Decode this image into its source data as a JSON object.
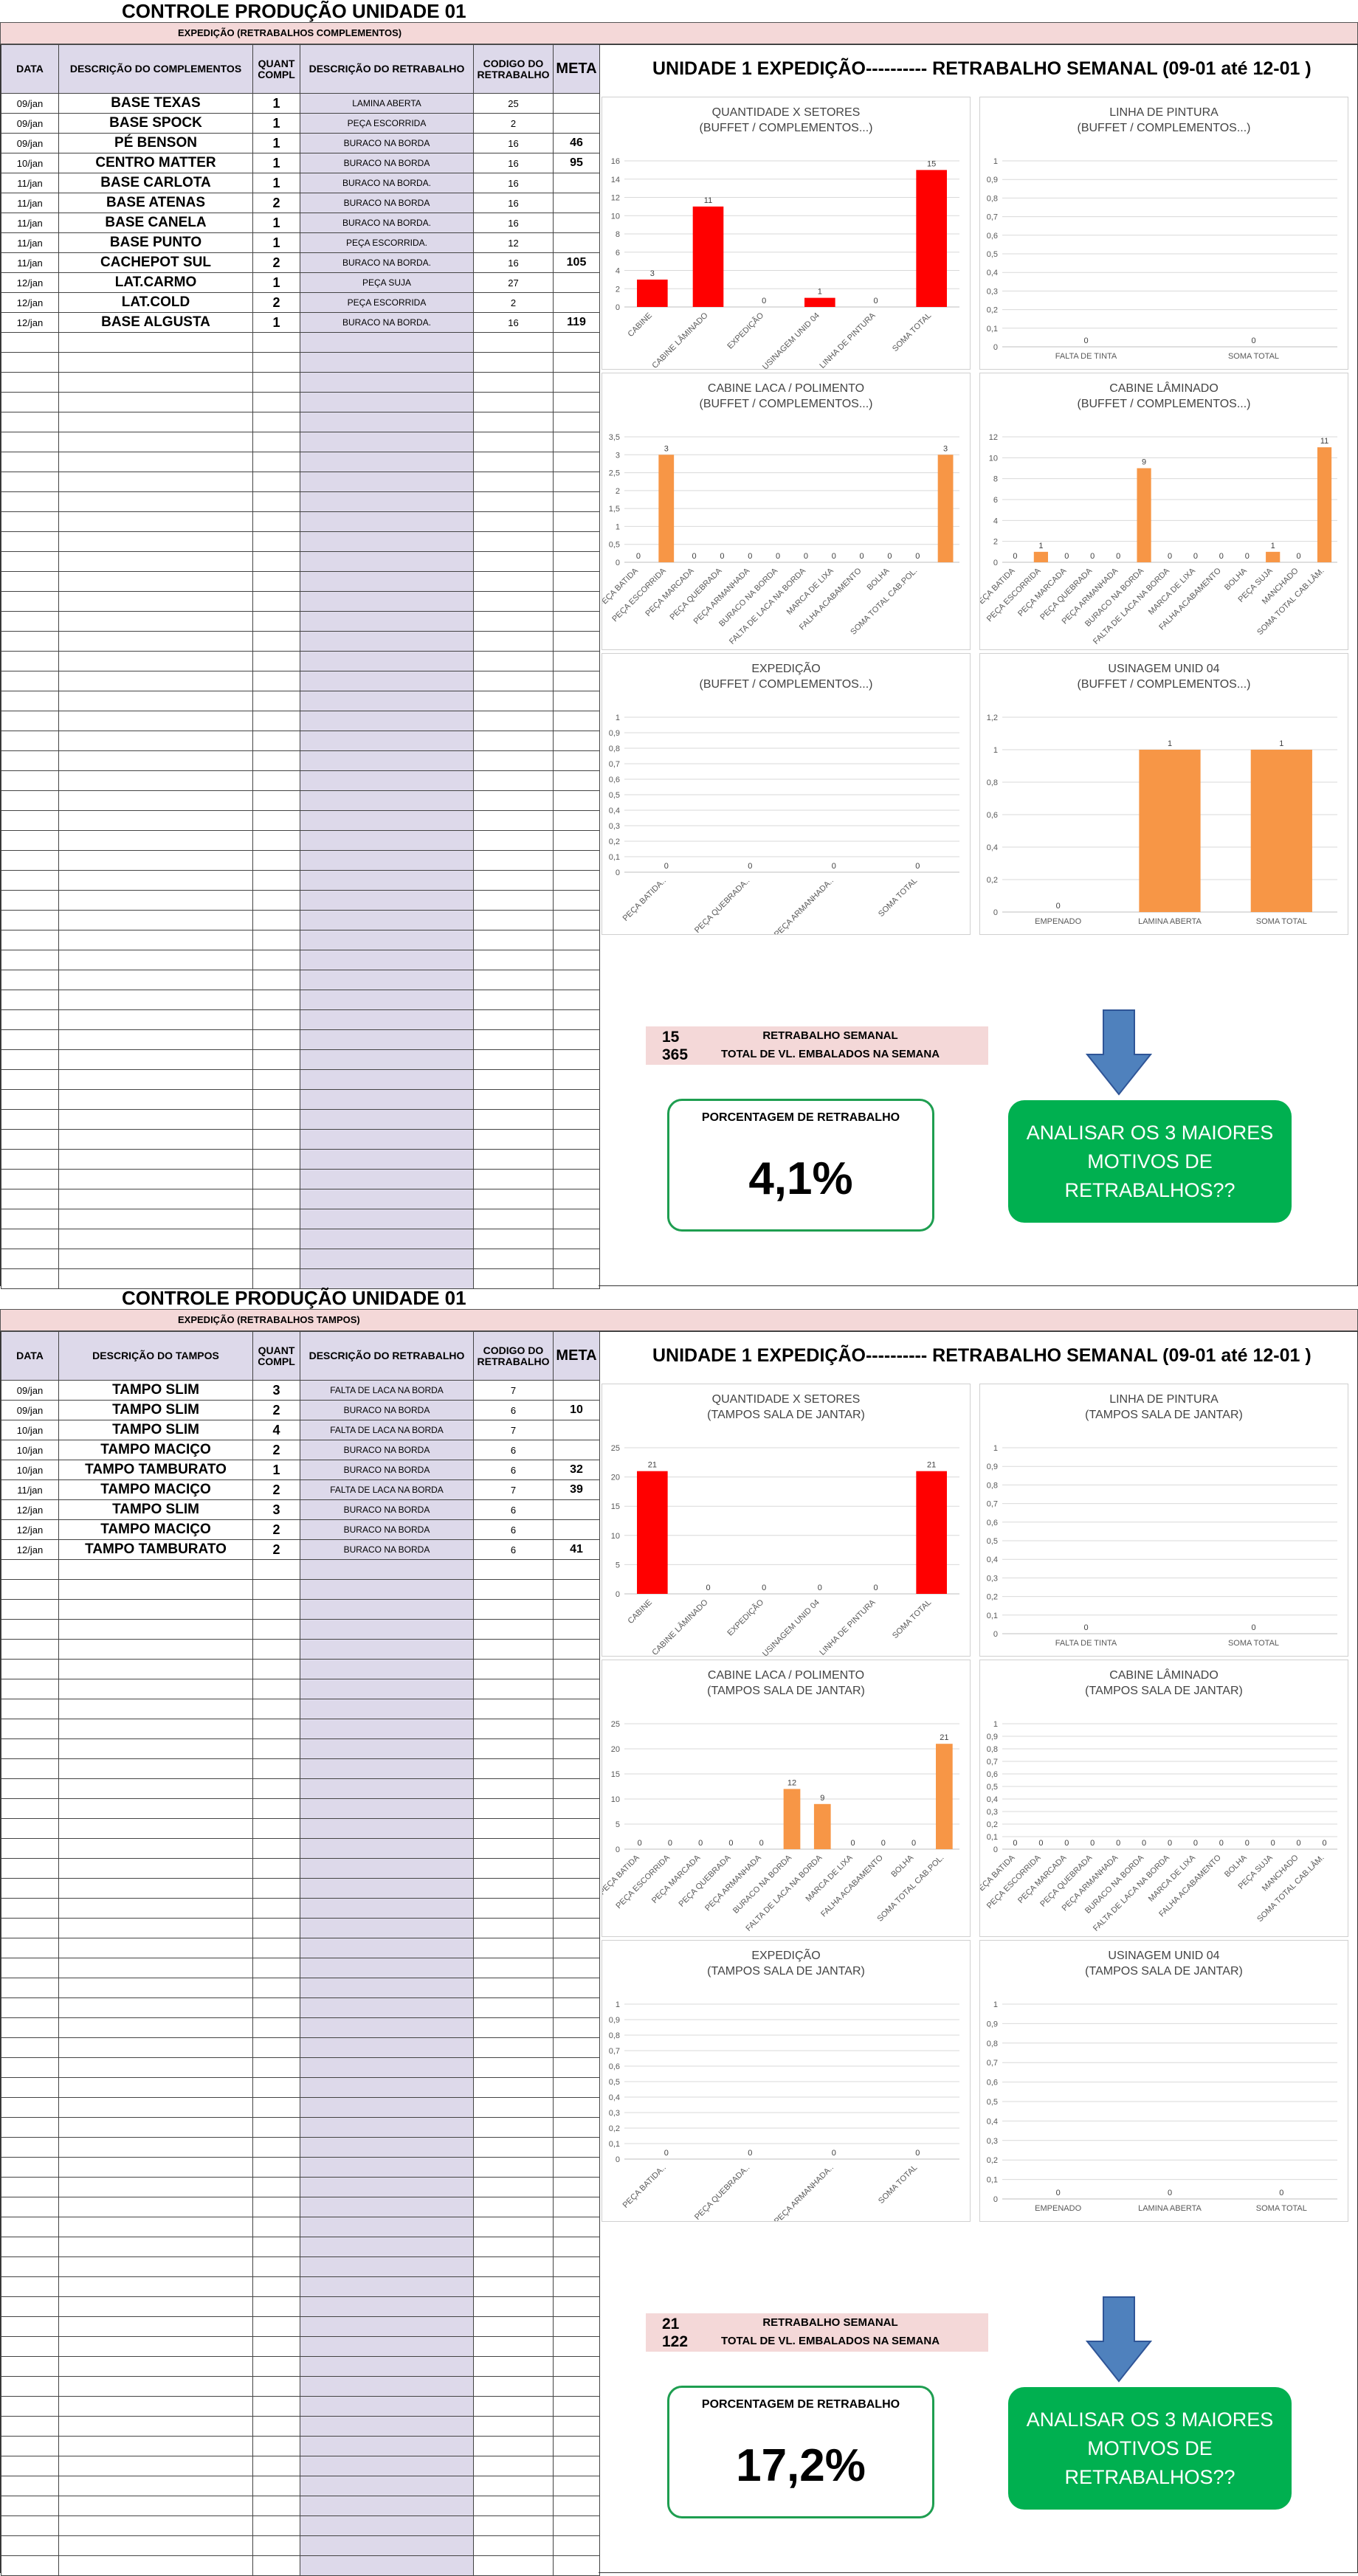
{
  "sections": [
    {
      "title": "CONTROLE PRODUÇÃO UNIDADE 01",
      "subtitle": "EXPEDIÇÃO (RETRABALHOS COMPLEMENTOS)",
      "headers": [
        "DATA",
        "DESCRIÇÃO DO COMPLEMENTOS",
        "QUANT COMPL",
        "DESCRIÇÃO DO RETRABALHO",
        "CODIGO DO RETRABALHO",
        "META"
      ],
      "rows": [
        [
          "09/jan",
          "BASE TEXAS",
          "1",
          "LAMINA ABERTA",
          "25",
          ""
        ],
        [
          "09/jan",
          "BASE SPOCK",
          "1",
          "PEÇA ESCORRIDA",
          "2",
          ""
        ],
        [
          "09/jan",
          "PÉ BENSON",
          "1",
          "BURACO NA BORDA",
          "16",
          "46"
        ],
        [
          "10/jan",
          "CENTRO MATTER",
          "1",
          "BURACO NA BORDA",
          "16",
          "95"
        ],
        [
          "11/jan",
          "BASE CARLOTA",
          "1",
          "BURACO NA BORDA.",
          "16",
          ""
        ],
        [
          "11/jan",
          "BASE ATENAS",
          "2",
          "BURACO NA BORDA",
          "16",
          ""
        ],
        [
          "11/jan",
          "BASE CANELA",
          "1",
          "BURACO NA BORDA.",
          "16",
          ""
        ],
        [
          "11/jan",
          "BASE PUNTO",
          "1",
          "PEÇA ESCORRIDA.",
          "12",
          ""
        ],
        [
          "11/jan",
          "CACHEPOT SUL",
          "2",
          "BURACO NA BORDA.",
          "16",
          "105"
        ],
        [
          "12/jan",
          "LAT.CARMO",
          "1",
          "PEÇA SUJA",
          "27",
          ""
        ],
        [
          "12/jan",
          "LAT.COLD",
          "2",
          "PEÇA ESCORRIDA",
          "2",
          ""
        ],
        [
          "12/jan",
          "BASE ALGUSTA",
          "1",
          "BURACO NA BORDA.",
          "16",
          "119"
        ]
      ],
      "right_title": "UNIDADE 1 EXPEDIÇÃO----------   RETRABALHO SEMANAL (09-01 até 12-01 )",
      "summary": {
        "retrabalho": "15",
        "retrabalho_label": "RETRABALHO SEMANAL",
        "embalados": "365",
        "embalados_label": "TOTAL DE VL. EMBALADOS NA SEMANA",
        "pct_label": "PORCENTAGEM DE RETRABALHO",
        "pct": "4,1%",
        "action": "ANALISAR OS 3 MAIORES MOTIVOS DE RETRABALHOS??"
      }
    },
    {
      "title": "CONTROLE PRODUÇÃO UNIDADE 01",
      "subtitle": "EXPEDIÇÃO (RETRABALHOS TAMPOS)",
      "headers": [
        "DATA",
        "DESCRIÇÃO DO TAMPOS",
        "QUANT COMPL",
        "DESCRIÇÃO DO RETRABALHO",
        "CODIGO DO RETRABALHO",
        "META"
      ],
      "rows": [
        [
          "09/jan",
          "TAMPO SLIM",
          "3",
          "FALTA DE LACA NA BORDA",
          "7",
          ""
        ],
        [
          "09/jan",
          "TAMPO SLIM",
          "2",
          "BURACO NA BORDA",
          "6",
          "10"
        ],
        [
          "10/jan",
          "TAMPO SLIM",
          "4",
          "FALTA DE LACA NA BORDA",
          "7",
          ""
        ],
        [
          "10/jan",
          "TAMPO MACIÇO",
          "2",
          "BURACO NA BORDA",
          "6",
          ""
        ],
        [
          "10/jan",
          "TAMPO TAMBURATO",
          "1",
          "BURACO NA BORDA",
          "6",
          "32"
        ],
        [
          "11/jan",
          "TAMPO MACIÇO",
          "2",
          "FALTA DE LACA NA BORDA",
          "7",
          "39"
        ],
        [
          "12/jan",
          "TAMPO SLIM",
          "3",
          "BURACO NA BORDA",
          "6",
          ""
        ],
        [
          "12/jan",
          "TAMPO MACIÇO",
          "2",
          "BURACO NA BORDA",
          "6",
          ""
        ],
        [
          "12/jan",
          "TAMPO TAMBURATO",
          "2",
          "BURACO NA BORDA",
          "6",
          "41"
        ]
      ],
      "right_title": "UNIDADE 1 EXPEDIÇÃO----------   RETRABALHO SEMANAL (09-01 até 12-01 )",
      "summary": {
        "retrabalho": "21",
        "retrabalho_label": "RETRABALHO SEMANAL",
        "embalados": "122",
        "embalados_label": "TOTAL DE VL. EMBALADOS NA SEMANA",
        "pct_label": "PORCENTAGEM DE RETRABALHO",
        "pct": "17,2%",
        "action": "ANALISAR OS 3 MAIORES MOTIVOS DE RETRABALHOS??"
      }
    }
  ],
  "colors": {
    "red": "#ff0000",
    "orange": "#f79646",
    "header_fill": "#ddd9ea",
    "pink": "#f4d8d8",
    "green": "#00b050",
    "arrow": "#4f81bd"
  },
  "chart_data": [
    {
      "type": "bar",
      "title": "QUANTIDADE X SETORES",
      "subtitle": "(BUFFET / COMPLEMENTOS...)",
      "color": "#ff0000",
      "categories": [
        "CABINE",
        "CABINE LÂMINADO",
        "EXPEDIÇÃO",
        "USINAGEM UNID 04",
        "LINHA DE PINTURA",
        "SOMA TOTAL"
      ],
      "values": [
        3,
        11,
        0,
        1,
        0,
        15
      ],
      "yticks": [
        "0",
        "2",
        "4",
        "6",
        "8",
        "10",
        "12",
        "14",
        "16"
      ],
      "ylim": [
        0,
        16
      ]
    },
    {
      "type": "bar",
      "title": "LINHA DE PINTURA",
      "subtitle": "(BUFFET / COMPLEMENTOS...)",
      "color": "#f79646",
      "categories": [
        "FALTA DE TINTA",
        "SOMA TOTAL"
      ],
      "values": [
        0,
        0
      ],
      "yticks": [
        "0",
        "0,1",
        "0,2",
        "0,3",
        "0,4",
        "0,5",
        "0,6",
        "0,7",
        "0,8",
        "0,9",
        "1"
      ],
      "ylim": [
        0,
        1
      ]
    },
    {
      "type": "bar",
      "title": "CABINE LACA / POLIMENTO",
      "subtitle": "(BUFFET / COMPLEMENTOS...)",
      "color": "#f79646",
      "categories": [
        "PEÇA BATIDA",
        "PEÇA ESCORRIDA",
        "PEÇA MARCADA",
        "PEÇA QUEBRADA",
        "PEÇA ARMANHADA",
        "BURACO NA BORDA",
        "FALTA DE LACA NA BORDA",
        "MARCA DE LIXA",
        "FALHA ACABAMENTO",
        "BOLHA",
        "SOMA TOTAL CAB.POL."
      ],
      "values": [
        0,
        3,
        0,
        0,
        0,
        0,
        0,
        0,
        0,
        0,
        0,
        3
      ],
      "yticks": [
        "0",
        "0,5",
        "1",
        "1,5",
        "2",
        "2,5",
        "3",
        "3,5"
      ],
      "ylim": [
        0,
        3.5
      ]
    },
    {
      "type": "bar",
      "title": "CABINE LÂMINADO",
      "subtitle": "(BUFFET / COMPLEMENTOS...)",
      "color": "#f79646",
      "categories": [
        "PEÇA BATIDA",
        "PEÇA ESCORRIDA",
        "PEÇA MARCADA",
        "PEÇA QUEBRADA",
        "PEÇA ARMANHADA",
        "BURACO NA BORDA",
        "FALTA DE LACA NA BORDA",
        "MARCA DE LIXA",
        "FALHA ACABAMENTO",
        "BOLHA",
        "PEÇA SUJA",
        "MANCHADO",
        "SOMA TOTAL CAB.LÂM."
      ],
      "values": [
        0,
        1,
        0,
        0,
        0,
        9,
        0,
        0,
        0,
        0,
        1,
        0,
        11
      ],
      "yticks": [
        "0",
        "2",
        "4",
        "6",
        "8",
        "10",
        "12"
      ],
      "ylim": [
        0,
        12
      ]
    },
    {
      "type": "bar",
      "title": "EXPEDIÇÃO",
      "subtitle": "(BUFFET / COMPLEMENTOS...)",
      "color": "#f79646",
      "categories": [
        "PEÇA BATIDA..",
        "PEÇA QUEBRADA..",
        "PEÇA ARMANHADA..",
        "SOMA TOTAL"
      ],
      "values": [
        0,
        0,
        0,
        0
      ],
      "yticks": [
        "0",
        "0,1",
        "0,2",
        "0,3",
        "0,4",
        "0,5",
        "0,6",
        "0,7",
        "0,8",
        "0,9",
        "1"
      ],
      "ylim": [
        0,
        1
      ]
    },
    {
      "type": "bar",
      "title": "USINAGEM UNID 04",
      "subtitle": "(BUFFET / COMPLEMENTOS...)",
      "color": "#f79646",
      "categories": [
        "EMPENADO",
        "LAMINA ABERTA",
        "SOMA TOTAL"
      ],
      "values": [
        0,
        1,
        1
      ],
      "yticks": [
        "0",
        "0,2",
        "0,4",
        "0,6",
        "0,8",
        "1",
        "1,2"
      ],
      "ylim": [
        0,
        1.2
      ]
    },
    {
      "type": "bar",
      "title": "QUANTIDADE X SETORES",
      "subtitle": "(TAMPOS SALA DE JANTAR)",
      "color": "#ff0000",
      "categories": [
        "CABINE",
        "CABINE LÂMINADO",
        "EXPEDIÇÃO",
        "USINAGEM UNID 04",
        "LINHA DE PINTURA",
        "SOMA TOTAL"
      ],
      "values": [
        21,
        0,
        0,
        0,
        0,
        21
      ],
      "yticks": [
        "0",
        "5",
        "10",
        "15",
        "20",
        "25"
      ],
      "ylim": [
        0,
        25
      ]
    },
    {
      "type": "bar",
      "title": "LINHA DE PINTURA",
      "subtitle": "(TAMPOS SALA DE JANTAR)",
      "color": "#f79646",
      "categories": [
        "FALTA DE TINTA",
        "SOMA TOTAL"
      ],
      "values": [
        0,
        0
      ],
      "yticks": [
        "0",
        "0,1",
        "0,2",
        "0,3",
        "0,4",
        "0,5",
        "0,6",
        "0,7",
        "0,8",
        "0,9",
        "1"
      ],
      "ylim": [
        0,
        1
      ]
    },
    {
      "type": "bar",
      "title": "CABINE LACA / POLIMENTO",
      "subtitle": "(TAMPOS SALA DE JANTAR)",
      "color": "#f79646",
      "categories": [
        "PEÇA BATIDA",
        "PEÇA ESCORRIDA",
        "PEÇA MARCADA",
        "PEÇA QUEBRADA",
        "PEÇA ARMANHADA",
        "BURACO NA BORDA",
        "FALTA DE LACA NA BORDA",
        "MARCA DE LIXA",
        "FALHA ACABAMENTO",
        "BOLHA",
        "SOMA TOTAL CAB.POL."
      ],
      "values": [
        0,
        0,
        0,
        0,
        0,
        12,
        9,
        0,
        0,
        0,
        21
      ],
      "yticks": [
        "0",
        "5",
        "10",
        "15",
        "20",
        "25"
      ],
      "ylim": [
        0,
        25
      ]
    },
    {
      "type": "bar",
      "title": "CABINE LÂMINADO",
      "subtitle": "(TAMPOS SALA DE JANTAR)",
      "color": "#f79646",
      "categories": [
        "PEÇA BATIDA",
        "PEÇA ESCORRIDA",
        "PEÇA MARCADA",
        "PEÇA QUEBRADA",
        "PEÇA ARMANHADA",
        "BURACO NA BORDA",
        "FALTA DE LACA NA BORDA",
        "MARCA DE LIXA",
        "FALHA ACABAMENTO",
        "BOLHA",
        "PEÇA SUJA",
        "MANCHADO",
        "SOMA TOTAL CAB.LÂM."
      ],
      "values": [
        0,
        0,
        0,
        0,
        0,
        0,
        0,
        0,
        0,
        0,
        0,
        0,
        0
      ],
      "yticks": [
        "0",
        "0,1",
        "0,2",
        "0,3",
        "0,4",
        "0,5",
        "0,6",
        "0,7",
        "0,8",
        "0,9",
        "1"
      ],
      "ylim": [
        0,
        1
      ]
    },
    {
      "type": "bar",
      "title": "EXPEDIÇÃO",
      "subtitle": "(TAMPOS SALA DE JANTAR)",
      "color": "#f79646",
      "categories": [
        "PEÇA BATIDA..",
        "PEÇA QUEBRADA..",
        "PEÇA ARMANHADA..",
        "SOMA TOTAL"
      ],
      "values": [
        0,
        0,
        0,
        0
      ],
      "yticks": [
        "0",
        "0,1",
        "0,2",
        "0,3",
        "0,4",
        "0,5",
        "0,6",
        "0,7",
        "0,8",
        "0,9",
        "1"
      ],
      "ylim": [
        0,
        1
      ]
    },
    {
      "type": "bar",
      "title": "USINAGEM UNID 04",
      "subtitle": "(TAMPOS SALA DE JANTAR)",
      "color": "#f79646",
      "categories": [
        "EMPENADO",
        "LAMINA ABERTA",
        "SOMA TOTAL"
      ],
      "values": [
        0,
        0,
        0
      ],
      "yticks": [
        "0",
        "0,1",
        "0,2",
        "0,3",
        "0,4",
        "0,5",
        "0,6",
        "0,7",
        "0,8",
        "0,9",
        "1"
      ],
      "ylim": [
        0,
        1
      ]
    }
  ]
}
